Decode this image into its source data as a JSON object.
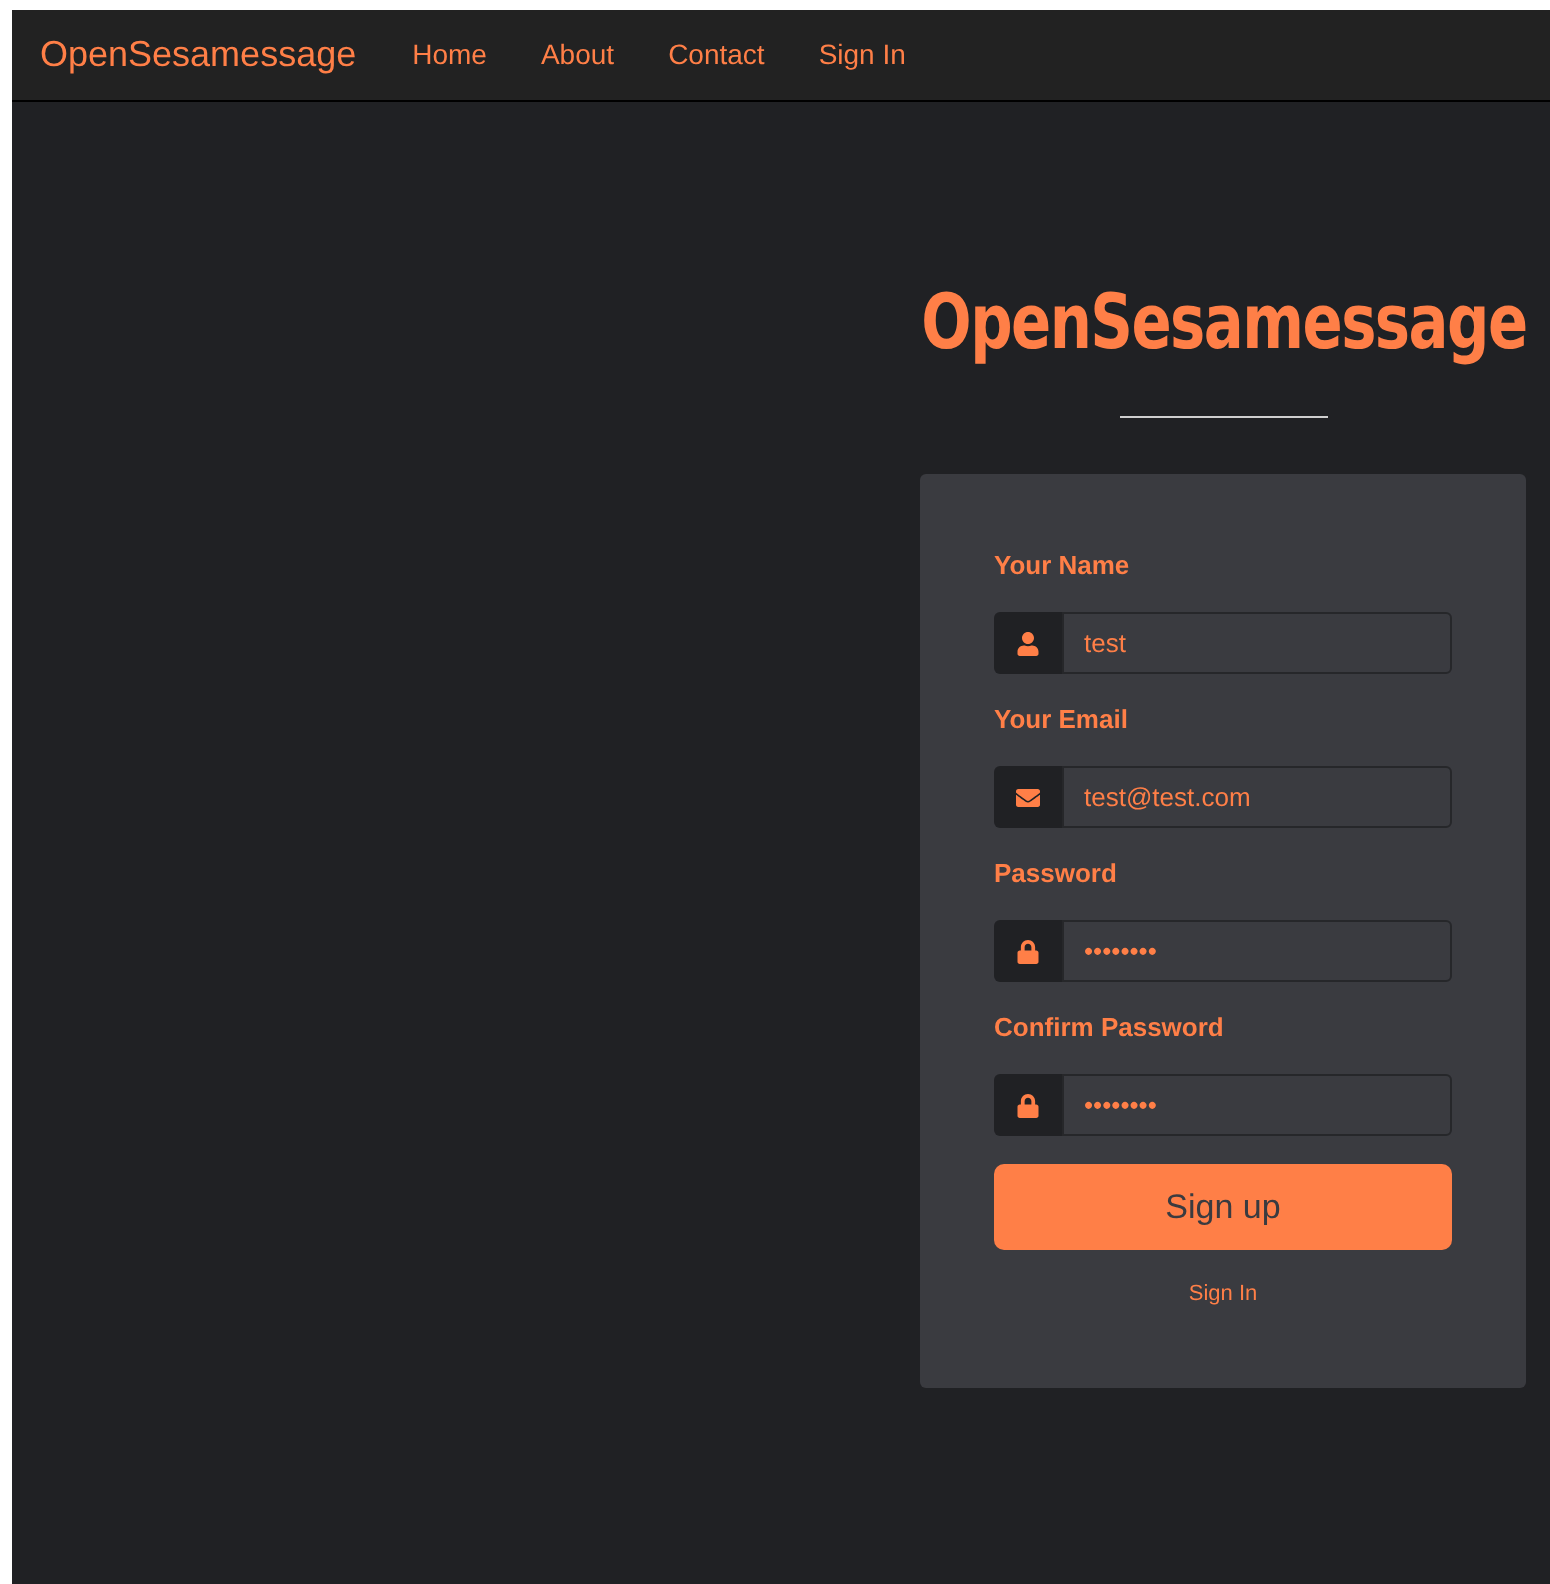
{
  "navbar": {
    "brand": "OpenSesamessage",
    "links": [
      {
        "label": "Home"
      },
      {
        "label": "About"
      },
      {
        "label": "Contact"
      },
      {
        "label": "Sign In"
      }
    ]
  },
  "hero": {
    "title": "OpenSesamessage"
  },
  "form": {
    "fields": [
      {
        "label": "Your Name",
        "kind": "name",
        "value": "test"
      },
      {
        "label": "Your Email",
        "kind": "email",
        "value": "test@test.com"
      },
      {
        "label": "Password",
        "kind": "password",
        "value": "••••••••"
      },
      {
        "label": "Confirm Password",
        "kind": "password",
        "value": "••••••••"
      }
    ],
    "submit": "Sign up",
    "link": "Sign In"
  }
}
